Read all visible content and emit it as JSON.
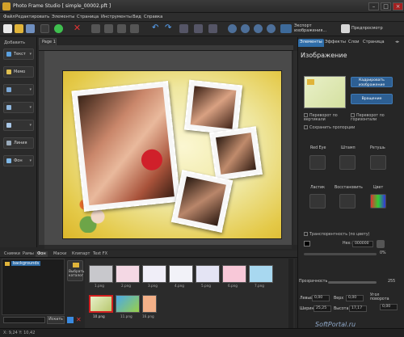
{
  "window": {
    "title": "Photo Frame Studio [ simple_00002.pft ]"
  },
  "menu": [
    "Файл",
    "Редактировать",
    "Элементы",
    "Страница",
    "Инструменты",
    "Вид",
    "Справка"
  ],
  "toolbar": {
    "export_label": "Экспорт изображения...",
    "preview_label": "Предпросмотр"
  },
  "left": {
    "add_label": "Добавить",
    "text_label": "Текст",
    "memo_label": "Мемо",
    "line_label": "Линия",
    "bg_label": "Фон"
  },
  "canvas": {
    "page_tab": "Page 1"
  },
  "right": {
    "tabs": [
      "Элементы",
      "Эффекты",
      "Слои",
      "Страница"
    ],
    "header": "Изображение",
    "crop_label": "Кадрировать изображение",
    "rotate_label": "Вращение",
    "flip_v": "Переворот по вертикали",
    "flip_h": "Переворот по горизонтали",
    "keep_prop": "Сохранить пропорции",
    "tools": [
      "Red Eye",
      "Штамп",
      "Ретушь",
      "Ластик",
      "Восстановить",
      "Цвет"
    ],
    "transparency_label": "Транспорентность (по цвету)",
    "hex_label": "Hex:",
    "hex_value": "000000",
    "opacity_label": "Прозрачность",
    "opacity_value": "255",
    "left_label": "Левый",
    "left_value": "0,00",
    "top_label": "Верх",
    "top_value": "0,00",
    "angle_label": "Угол поворота",
    "angle_value": "0,00",
    "width_label": "Ширина",
    "width_value": "25,25",
    "height_label": "Высота",
    "height_value": "17,17",
    "pct_label": "%",
    "pct_value": "0%"
  },
  "bottom": {
    "tabs": [
      "Снимки",
      "Рамы",
      "Фон",
      "Маски",
      "Клипарт",
      "Text FX"
    ],
    "tree_item": "backgrounds",
    "select_folder": "Выбрать каталог",
    "search_placeholder": "Искать",
    "thumbs": [
      "1.png",
      "2.png",
      "3.png",
      "4.png",
      "5.png",
      "6.png",
      "7.png",
      "10.png",
      "11.png",
      "16.png"
    ]
  },
  "status": {
    "coords": "X: 9,24 Y: 10,42",
    "watermark": "SoftPortal.ru"
  },
  "colors": {
    "accent": "#2f6da8",
    "bg": "#262626"
  }
}
